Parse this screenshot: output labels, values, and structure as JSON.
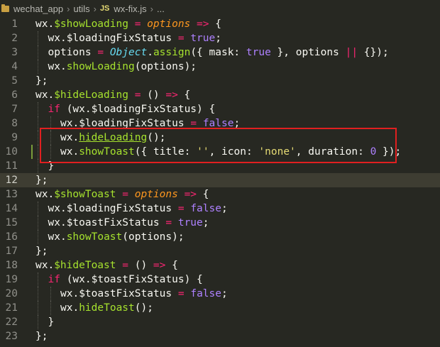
{
  "breadcrumb": {
    "folder": "wechat_app",
    "subfolder": "utils",
    "file_badge": "JS",
    "file": "wx-fix.js",
    "more": "..."
  },
  "editor": {
    "current_line": 12,
    "lines": [
      {
        "n": "1",
        "indent": 0,
        "tokens": [
          [
            "t-obj",
            "wx."
          ],
          [
            "t-fn",
            "$showLoading"
          ],
          [
            "t-punc",
            " "
          ],
          [
            "t-kw",
            "="
          ],
          [
            "t-punc",
            " "
          ],
          [
            "t-param",
            "options"
          ],
          [
            "t-punc",
            " "
          ],
          [
            "t-kw",
            "=>"
          ],
          [
            "t-punc",
            " {"
          ]
        ]
      },
      {
        "n": "2",
        "indent": 1,
        "tokens": [
          [
            "t-obj",
            "wx.$loadingFixStatus"
          ],
          [
            "t-punc",
            " "
          ],
          [
            "t-kw",
            "="
          ],
          [
            "t-punc",
            " "
          ],
          [
            "t-bool",
            "true"
          ],
          [
            "t-punc",
            ";"
          ]
        ]
      },
      {
        "n": "3",
        "indent": 1,
        "tokens": [
          [
            "t-obj",
            "options"
          ],
          [
            "t-punc",
            " "
          ],
          [
            "t-kw",
            "="
          ],
          [
            "t-punc",
            " "
          ],
          [
            "t-type",
            "Object"
          ],
          [
            "t-punc",
            "."
          ],
          [
            "t-fn",
            "assign"
          ],
          [
            "t-punc",
            "({ mask: "
          ],
          [
            "t-bool",
            "true"
          ],
          [
            "t-punc",
            " }, options "
          ],
          [
            "t-kw",
            "||"
          ],
          [
            "t-punc",
            " {});"
          ]
        ]
      },
      {
        "n": "4",
        "indent": 1,
        "tokens": [
          [
            "t-obj",
            "wx."
          ],
          [
            "t-fn",
            "showLoading"
          ],
          [
            "t-punc",
            "(options);"
          ]
        ]
      },
      {
        "n": "5",
        "indent": 0,
        "tokens": [
          [
            "t-punc",
            "};"
          ]
        ]
      },
      {
        "n": "6",
        "indent": 0,
        "tokens": [
          [
            "t-obj",
            "wx."
          ],
          [
            "t-fn",
            "$hideLoading"
          ],
          [
            "t-punc",
            " "
          ],
          [
            "t-kw",
            "="
          ],
          [
            "t-punc",
            " () "
          ],
          [
            "t-kw",
            "=>"
          ],
          [
            "t-punc",
            " {"
          ]
        ]
      },
      {
        "n": "7",
        "indent": 1,
        "tokens": [
          [
            "t-kw",
            "if"
          ],
          [
            "t-punc",
            " (wx.$loadingFixStatus) {"
          ]
        ]
      },
      {
        "n": "8",
        "indent": 2,
        "tokens": [
          [
            "t-obj",
            "wx.$loadingFixStatus"
          ],
          [
            "t-punc",
            " "
          ],
          [
            "t-kw",
            "="
          ],
          [
            "t-punc",
            " "
          ],
          [
            "t-bool",
            "false"
          ],
          [
            "t-punc",
            ";"
          ]
        ]
      },
      {
        "n": "9",
        "indent": 2,
        "tokens": [
          [
            "t-obj",
            "wx."
          ],
          [
            "t-fnu",
            "hideLoading"
          ],
          [
            "t-punc",
            "();"
          ]
        ]
      },
      {
        "n": "10",
        "indent": 2,
        "mod": true,
        "tokens": [
          [
            "t-obj",
            "wx."
          ],
          [
            "t-fn",
            "showToast"
          ],
          [
            "t-punc",
            "({ title: "
          ],
          [
            "t-str",
            "''"
          ],
          [
            "t-punc",
            ", icon: "
          ],
          [
            "t-str",
            "'none'"
          ],
          [
            "t-punc",
            ", duration: "
          ],
          [
            "t-num",
            "0"
          ],
          [
            "t-punc",
            " });"
          ]
        ]
      },
      {
        "n": "11",
        "indent": 1,
        "tokens": [
          [
            "t-punc",
            "}"
          ]
        ]
      },
      {
        "n": "12",
        "indent": 0,
        "tokens": [
          [
            "t-punc",
            "};"
          ]
        ]
      },
      {
        "n": "13",
        "indent": 0,
        "tokens": [
          [
            "t-obj",
            "wx."
          ],
          [
            "t-fn",
            "$showToast"
          ],
          [
            "t-punc",
            " "
          ],
          [
            "t-kw",
            "="
          ],
          [
            "t-punc",
            " "
          ],
          [
            "t-param",
            "options"
          ],
          [
            "t-punc",
            " "
          ],
          [
            "t-kw",
            "=>"
          ],
          [
            "t-punc",
            " {"
          ]
        ]
      },
      {
        "n": "14",
        "indent": 1,
        "tokens": [
          [
            "t-obj",
            "wx.$loadingFixStatus"
          ],
          [
            "t-punc",
            " "
          ],
          [
            "t-kw",
            "="
          ],
          [
            "t-punc",
            " "
          ],
          [
            "t-bool",
            "false"
          ],
          [
            "t-punc",
            ";"
          ]
        ]
      },
      {
        "n": "15",
        "indent": 1,
        "tokens": [
          [
            "t-obj",
            "wx.$toastFixStatus"
          ],
          [
            "t-punc",
            " "
          ],
          [
            "t-kw",
            "="
          ],
          [
            "t-punc",
            " "
          ],
          [
            "t-bool",
            "true"
          ],
          [
            "t-punc",
            ";"
          ]
        ]
      },
      {
        "n": "16",
        "indent": 1,
        "tokens": [
          [
            "t-obj",
            "wx."
          ],
          [
            "t-fn",
            "showToast"
          ],
          [
            "t-punc",
            "(options);"
          ]
        ]
      },
      {
        "n": "17",
        "indent": 0,
        "tokens": [
          [
            "t-punc",
            "};"
          ]
        ]
      },
      {
        "n": "18",
        "indent": 0,
        "tokens": [
          [
            "t-obj",
            "wx."
          ],
          [
            "t-fn",
            "$hideToast"
          ],
          [
            "t-punc",
            " "
          ],
          [
            "t-kw",
            "="
          ],
          [
            "t-punc",
            " () "
          ],
          [
            "t-kw",
            "=>"
          ],
          [
            "t-punc",
            " {"
          ]
        ]
      },
      {
        "n": "19",
        "indent": 1,
        "tokens": [
          [
            "t-kw",
            "if"
          ],
          [
            "t-punc",
            " (wx.$toastFixStatus) {"
          ]
        ]
      },
      {
        "n": "20",
        "indent": 2,
        "tokens": [
          [
            "t-obj",
            "wx.$toastFixStatus"
          ],
          [
            "t-punc",
            " "
          ],
          [
            "t-kw",
            "="
          ],
          [
            "t-punc",
            " "
          ],
          [
            "t-bool",
            "false"
          ],
          [
            "t-punc",
            ";"
          ]
        ]
      },
      {
        "n": "21",
        "indent": 2,
        "tokens": [
          [
            "t-obj",
            "wx."
          ],
          [
            "t-fn",
            "hideToast"
          ],
          [
            "t-punc",
            "();"
          ]
        ]
      },
      {
        "n": "22",
        "indent": 1,
        "tokens": [
          [
            "t-punc",
            "}"
          ]
        ]
      },
      {
        "n": "23",
        "indent": 0,
        "tokens": [
          [
            "t-punc",
            "};"
          ]
        ]
      }
    ]
  }
}
